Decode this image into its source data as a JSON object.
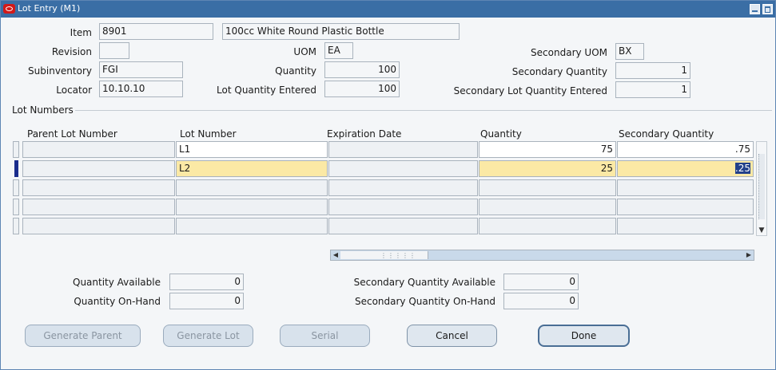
{
  "window": {
    "title": "Lot Entry (M1)"
  },
  "header": {
    "item_label": "Item",
    "item_value": "8901",
    "item_description": "100cc White Round Plastic Bottle",
    "revision_label": "Revision",
    "revision_value": "",
    "uom_label": "UOM",
    "uom_value": "EA",
    "secondary_uom_label": "Secondary UOM",
    "secondary_uom_value": "BX",
    "subinventory_label": "Subinventory",
    "subinventory_value": "FGI",
    "quantity_label": "Quantity",
    "quantity_value": "100",
    "secondary_quantity_label": "Secondary Quantity",
    "secondary_quantity_value": "1",
    "locator_label": "Locator",
    "locator_value": "10.10.10",
    "lot_qty_entered_label": "Lot Quantity Entered",
    "lot_qty_entered_value": "100",
    "secondary_lot_qty_entered_label": "Secondary Lot Quantity Entered",
    "secondary_lot_qty_entered_value": "1"
  },
  "lot_numbers": {
    "section_label": "Lot Numbers",
    "columns": [
      "Parent Lot Number",
      "Lot Number",
      "Expiration Date",
      "Quantity",
      "Secondary Quantity"
    ],
    "rows": [
      {
        "parent": "",
        "lot": "L1",
        "expiration": "",
        "quantity": "75",
        "secondary_quantity": ".75"
      },
      {
        "parent": "",
        "lot": "L2",
        "expiration": "",
        "quantity": "25",
        "secondary_quantity": ".25"
      },
      {
        "parent": "",
        "lot": "",
        "expiration": "",
        "quantity": "",
        "secondary_quantity": ""
      },
      {
        "parent": "",
        "lot": "",
        "expiration": "",
        "quantity": "",
        "secondary_quantity": ""
      },
      {
        "parent": "",
        "lot": "",
        "expiration": "",
        "quantity": "",
        "secondary_quantity": ""
      }
    ]
  },
  "summary": {
    "qty_available_label": "Quantity Available",
    "qty_available_value": "0",
    "qty_onhand_label": "Quantity On-Hand",
    "qty_onhand_value": "0",
    "sec_qty_available_label": "Secondary Quantity Available",
    "sec_qty_available_value": "0",
    "sec_qty_onhand_label": "Secondary Quantity On-Hand",
    "sec_qty_onhand_value": "0"
  },
  "buttons": {
    "generate_parent": "Generate Parent",
    "generate_lot": "Generate Lot",
    "serial": "Serial",
    "cancel": "Cancel",
    "done": "Done"
  },
  "colors": {
    "title_bar": "#3a6ea5",
    "current_row": "#fbe9a5",
    "selection": "#22408a"
  }
}
